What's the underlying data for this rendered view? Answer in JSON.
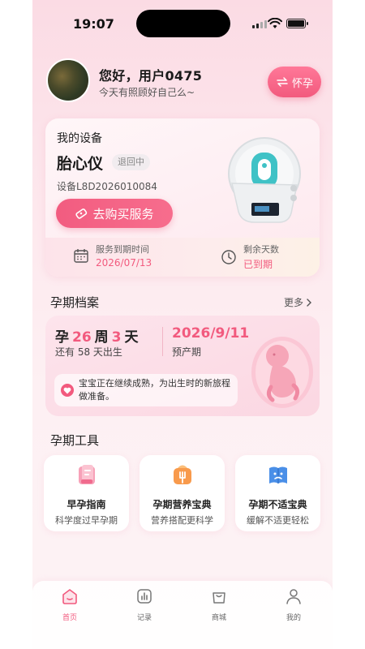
{
  "status_bar": {
    "time": "19:07"
  },
  "header": {
    "greeting": "您好，用户0475",
    "subtitle": "今天有照顾好自己么~",
    "mode_button": "怀孕"
  },
  "device_card": {
    "title": "我的设备",
    "device_name": "胎心仪",
    "status": "退回中",
    "device_id": "设备L8D2026010084",
    "buy_button": "去购买服务",
    "expiry_label": "服务到期时间",
    "expiry_value": "2026/07/13",
    "remaining_label": "剩余天数",
    "remaining_value": "已到期"
  },
  "pregnancy": {
    "section_title": "孕期档案",
    "more": "更多",
    "week_prefix": "孕",
    "weeks": "26",
    "week_unit": "周",
    "days": "3",
    "day_unit": "天",
    "due_sub": "还有 58 天出生",
    "due_date": "2026/9/11",
    "due_label": "预产期",
    "tip": "宝宝正在继续成熟，为出生时的新旅程做准备。"
  },
  "tools": {
    "section_title": "孕期工具",
    "items": [
      {
        "name": "早孕指南",
        "desc": "科学度过早孕期",
        "icon": "guide-book-icon"
      },
      {
        "name": "孕期营养宝典",
        "desc": "营养搭配更科学",
        "icon": "nutrition-icon"
      },
      {
        "name": "孕期不适宝典",
        "desc": "缓解不适更轻松",
        "icon": "discomfort-book-icon"
      }
    ]
  },
  "tabbar": {
    "items": [
      {
        "label": "首页",
        "icon": "home-icon"
      },
      {
        "label": "记录",
        "icon": "chart-icon"
      },
      {
        "label": "商城",
        "icon": "shopping-bag-icon"
      },
      {
        "label": "我的",
        "icon": "user-icon"
      }
    ]
  },
  "colors": {
    "accent": "#f25a7e",
    "background": "#fde9ee"
  }
}
